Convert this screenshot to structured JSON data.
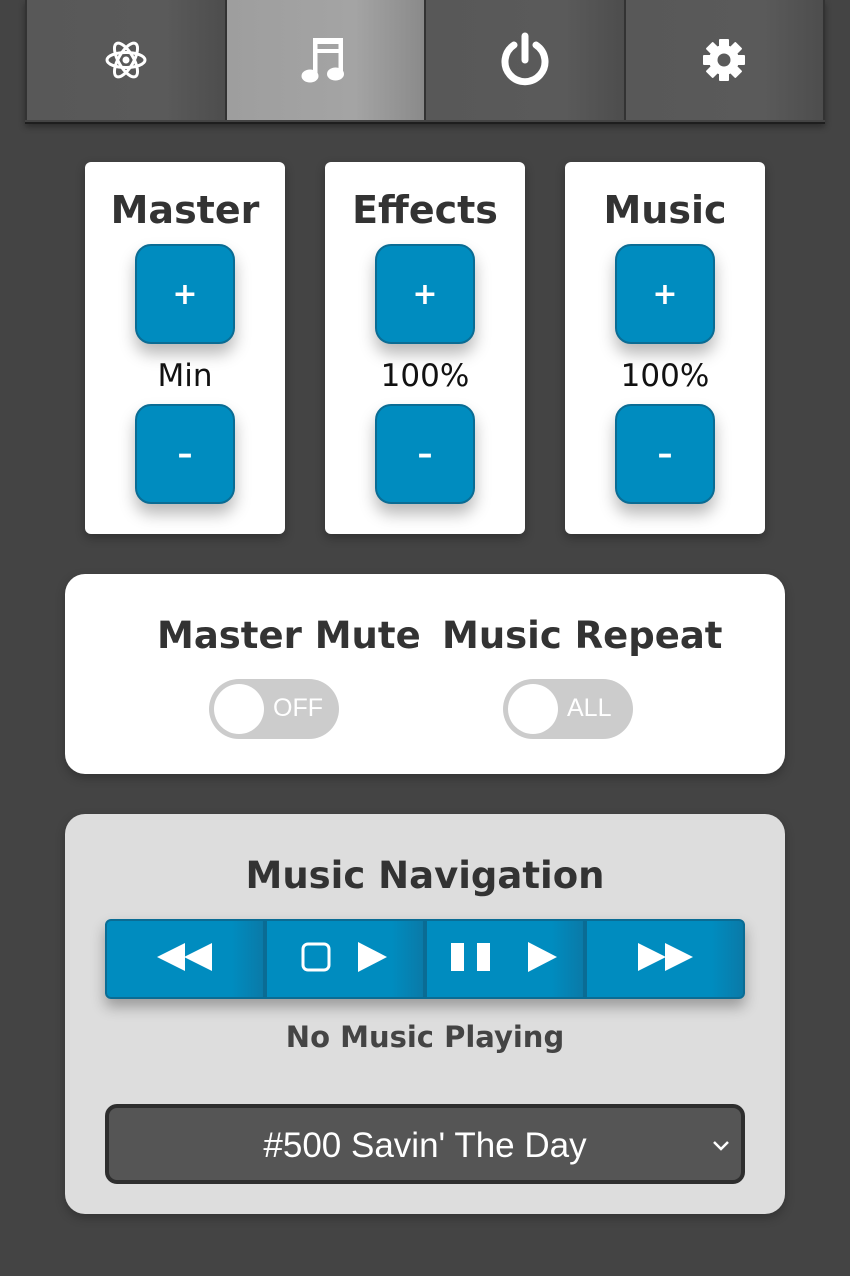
{
  "tabs": [
    {
      "icon": "atom-icon",
      "active": false
    },
    {
      "icon": "music-note-icon",
      "active": true
    },
    {
      "icon": "power-icon",
      "active": false
    },
    {
      "icon": "gear-icon",
      "active": false
    }
  ],
  "volume": {
    "master": {
      "title": "Master",
      "value": "Min",
      "plus": "+",
      "minus": "–"
    },
    "effects": {
      "title": "Effects",
      "value": "100%",
      "plus": "+",
      "minus": "–"
    },
    "music": {
      "title": "Music",
      "value": "100%",
      "plus": "+",
      "minus": "–"
    }
  },
  "toggles": {
    "master_mute": {
      "label": "Master Mute",
      "state": "OFF"
    },
    "music_repeat": {
      "label": "Music Repeat",
      "state": "ALL"
    }
  },
  "music_nav": {
    "title": "Music Navigation",
    "buttons": [
      "rewind-icon",
      "stop-play-icon",
      "pause-play-icon",
      "fast-forward-icon"
    ],
    "status": "No Music Playing",
    "selected_track": "#500 Savin' The Day"
  },
  "colors": {
    "background": "#444444",
    "accent": "#008cbf",
    "card": "#ffffff",
    "nav_card": "#dddddd"
  }
}
